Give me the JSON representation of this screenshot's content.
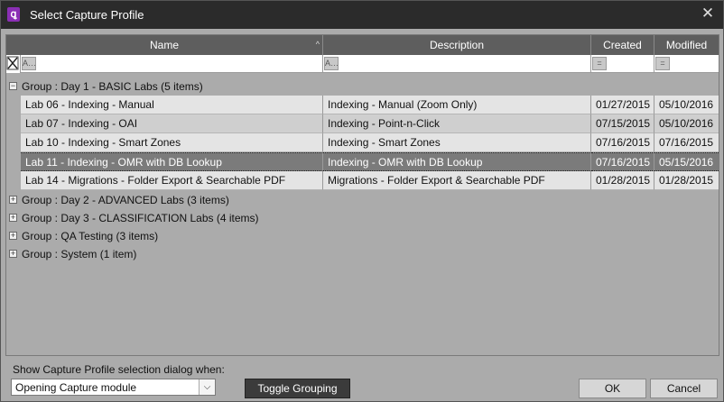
{
  "window": {
    "title": "Select Capture Profile"
  },
  "grid": {
    "columns": [
      "Name",
      "Description",
      "Created",
      "Modified"
    ],
    "groups": [
      {
        "label": "Group : Day 1 - BASIC Labs (5 items)",
        "expanded": true,
        "rows": [
          {
            "name": "Lab 06 - Indexing - Manual",
            "description": "Indexing - Manual (Zoom Only)",
            "created": "01/27/2015",
            "modified": "05/10/2016"
          },
          {
            "name": "Lab 07 - Indexing - OAI",
            "description": "Indexing - Point-n-Click",
            "created": "07/15/2015",
            "modified": "05/10/2016"
          },
          {
            "name": "Lab 10 - Indexing - Smart Zones",
            "description": "Indexing - Smart Zones",
            "created": "07/16/2015",
            "modified": "07/16/2015"
          },
          {
            "name": "Lab 11 - Indexing - OMR with DB Lookup",
            "description": "Indexing - OMR with DB Lookup",
            "created": "07/16/2015",
            "modified": "05/15/2016",
            "selected": true
          },
          {
            "name": "Lab 14 - Migrations - Folder Export & Searchable PDF",
            "description": "Migrations - Folder Export & Searchable PDF",
            "created": "01/28/2015",
            "modified": "01/28/2015"
          }
        ]
      },
      {
        "label": "Group : Day 2 - ADVANCED Labs (3 items)",
        "expanded": false
      },
      {
        "label": "Group : Day 3 - CLASSIFICATION Labs (4 items)",
        "expanded": false
      },
      {
        "label": "Group : QA Testing (3 items)",
        "expanded": false
      },
      {
        "label": "Group : System (1 item)",
        "expanded": false
      }
    ]
  },
  "footer": {
    "show_label": "Show Capture Profile selection dialog when:",
    "show_value": "Opening Capture module",
    "toggle_grouping": "Toggle Grouping",
    "ok": "OK",
    "cancel": "Cancel"
  },
  "icons": {
    "app": "app-logo-icon",
    "close": "close-icon",
    "text_filter": "text-filter-icon",
    "equals_filter": "equals-filter-icon",
    "clear_filter": "clear-filter-icon"
  },
  "colors": {
    "titlebar": "#2b2b2b",
    "header": "#5e5e5e",
    "selected_row": "#7b7b7b",
    "app_icon": "#8b2fb5"
  }
}
